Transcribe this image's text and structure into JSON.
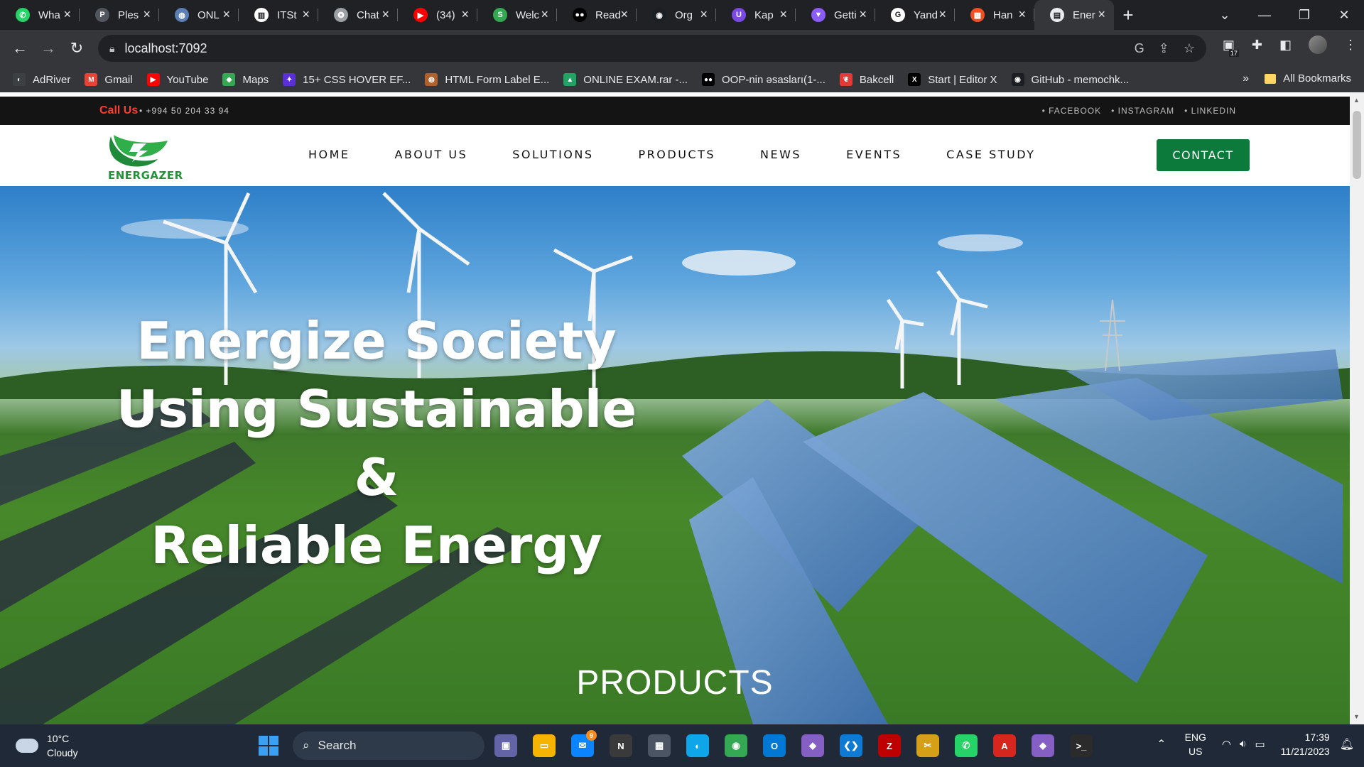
{
  "browser": {
    "tabs": [
      {
        "label": "Wha",
        "icon": "whatsapp-icon",
        "color": "#25d366",
        "glyph": "✆"
      },
      {
        "label": "Ples",
        "icon": "plesk-icon",
        "color": "#52565e",
        "glyph": "P"
      },
      {
        "label": "ONL",
        "icon": "globe-icon",
        "color": "#5b7fb4",
        "glyph": "◍"
      },
      {
        "label": "ITSt",
        "icon": "trello-icon",
        "color": "#ffffff",
        "glyph": "▥"
      },
      {
        "label": "Chat",
        "icon": "chatgpt-icon",
        "color": "#9aa0a6",
        "glyph": "❂"
      },
      {
        "label": "(34)",
        "icon": "youtube-icon",
        "color": "#ff0000",
        "glyph": "▶"
      },
      {
        "label": "Welc",
        "icon": "learnpath-icon",
        "color": "#34a853",
        "glyph": "S"
      },
      {
        "label": "Read",
        "icon": "medium-icon",
        "color": "#000000",
        "glyph": "●●"
      },
      {
        "label": "Org",
        "icon": "github-icon",
        "color": "#1b1f23",
        "glyph": "◉"
      },
      {
        "label": "Kap",
        "icon": "kap-icon",
        "color": "#7b4ae2",
        "glyph": "U"
      },
      {
        "label": "Getti",
        "icon": "vite-icon",
        "color": "#8b5cf6",
        "glyph": "▼"
      },
      {
        "label": "Yand",
        "icon": "google-icon",
        "color": "#ffffff",
        "glyph": "G"
      },
      {
        "label": "Han",
        "icon": "microsoft-icon",
        "color": "#f25022",
        "glyph": "▦"
      },
      {
        "label": "Ener",
        "icon": "page-icon",
        "color": "#e8eaed",
        "glyph": "▤",
        "active": true
      }
    ],
    "new_tab": "+",
    "url": "localhost:7092",
    "extension_badge": "17"
  },
  "bookmarks": [
    {
      "label": "AdRiver",
      "icon": "adriver-icon",
      "color": "#3c4043",
      "glyph": "◐"
    },
    {
      "label": "Gmail",
      "icon": "gmail-icon",
      "color": "#ea4335",
      "glyph": "M"
    },
    {
      "label": "YouTube",
      "icon": "youtube-icon",
      "color": "#ff0000",
      "glyph": "▶"
    },
    {
      "label": "Maps",
      "icon": "maps-icon",
      "color": "#34a853",
      "glyph": "◆"
    },
    {
      "label": "15+ CSS HOVER EF...",
      "icon": "puzzle-icon",
      "color": "#5a2fd6",
      "glyph": "✦"
    },
    {
      "label": "HTML Form Label E...",
      "icon": "globe-icon",
      "color": "#b0602a",
      "glyph": "◍"
    },
    {
      "label": "ONLINE EXAM.rar -...",
      "icon": "drive-icon",
      "color": "#1fa463",
      "glyph": "▲"
    },
    {
      "label": "OOP-nin əsasları(1-...",
      "icon": "medium-icon",
      "color": "#000000",
      "glyph": "●●"
    },
    {
      "label": "Bakcell",
      "icon": "bakcell-icon",
      "color": "#e53935",
      "glyph": "❦"
    },
    {
      "label": "Start | Editor X",
      "icon": "editorx-icon",
      "color": "#000000",
      "glyph": "X"
    },
    {
      "label": "GitHub - memochk...",
      "icon": "github-icon",
      "color": "#1b1f23",
      "glyph": "◉"
    }
  ],
  "bookmarks_more": "»",
  "all_bookmarks": "All Bookmarks",
  "site": {
    "topbar": {
      "call_label": "Call Us",
      "phone": "• +994 50 204 33 94",
      "social": [
        "• FACEBOOK",
        "• INSTAGRAM",
        "• LINKEDIN"
      ]
    },
    "logo_text": "ENERGAZER",
    "menu": [
      "HOME",
      "ABOUT US",
      "SOLUTIONS",
      "PRODUCTS",
      "NEWS",
      "EVENTS",
      "CASE STUDY"
    ],
    "contact_button": "CONTACT",
    "hero": {
      "title_lines": [
        "Energize Society",
        "Using Sustainable &",
        "Reliable Energy"
      ],
      "section_heading": "PRODUCTS"
    }
  },
  "taskbar": {
    "weather_temp": "10°C",
    "weather_desc": "Cloudy",
    "search_label": "Search",
    "apps": [
      {
        "icon": "teams-icon",
        "color": "#6264a7",
        "glyph": "▣"
      },
      {
        "icon": "file-explorer-icon",
        "color": "#f4b400",
        "glyph": "▭"
      },
      {
        "icon": "mail-icon",
        "color": "#0a84ff",
        "glyph": "✉",
        "badge": "9"
      },
      {
        "icon": "notion-icon",
        "color": "#3a3a3a",
        "glyph": "N"
      },
      {
        "icon": "calculator-icon",
        "color": "#4b5563",
        "glyph": "▦"
      },
      {
        "icon": "edge-icon",
        "color": "#0ea5e9",
        "glyph": "◐"
      },
      {
        "icon": "chrome-icon",
        "color": "#34a853",
        "glyph": "◉"
      },
      {
        "icon": "outlook-icon",
        "color": "#0078d4",
        "glyph": "O"
      },
      {
        "icon": "visual-studio-icon",
        "color": "#865fc5",
        "glyph": "◆"
      },
      {
        "icon": "vscode-icon",
        "color": "#0e7ad3",
        "glyph": "❮❯"
      },
      {
        "icon": "filezilla-icon",
        "color": "#bf0000",
        "glyph": "Z"
      },
      {
        "icon": "snip-icon",
        "color": "#d4a017",
        "glyph": "✂"
      },
      {
        "icon": "whatsapp-icon",
        "color": "#25d366",
        "glyph": "✆"
      },
      {
        "icon": "acrobat-icon",
        "color": "#d7261e",
        "glyph": "A"
      },
      {
        "icon": "visual-studio-icon",
        "color": "#865fc5",
        "glyph": "◆"
      },
      {
        "icon": "terminal-icon",
        "color": "#2b2b2b",
        "glyph": ">_"
      }
    ],
    "lang_top": "ENG",
    "lang_bottom": "US",
    "time": "17:39",
    "date": "11/21/2023"
  }
}
